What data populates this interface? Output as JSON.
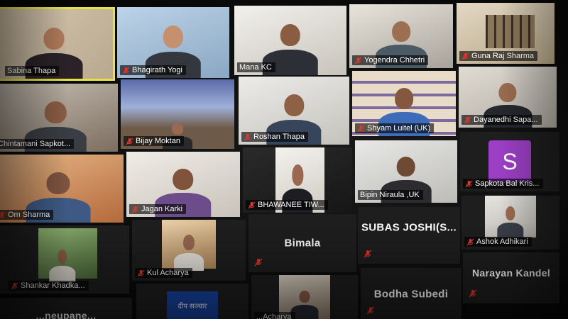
{
  "participants": [
    {
      "name": "Sabina Thapa",
      "muted": false,
      "active": true
    },
    {
      "name": "Bhagirath Yogi",
      "muted": true
    },
    {
      "name": "Mana KC",
      "muted": false
    },
    {
      "name": "Yogendra Chhetri",
      "muted": true
    },
    {
      "name": "Guna Raj Sharma",
      "muted": true
    },
    {
      "name": "Chintamani Sapkot...",
      "muted": false
    },
    {
      "name": "Bijay Moktan",
      "muted": true
    },
    {
      "name": "Roshan Thapa",
      "muted": true
    },
    {
      "name": "Shyam Luitel (UK)",
      "muted": true
    },
    {
      "name": "Dayanedhi Sapa...",
      "muted": true
    },
    {
      "name": "Om Sharma",
      "muted": true
    },
    {
      "name": "Jagan Karki",
      "muted": true
    },
    {
      "name": "BHAWANEE TIW...",
      "muted": true
    },
    {
      "name": "Bipin Niraula ,UK",
      "muted": false
    },
    {
      "name": "Sapkota Bal Kris...",
      "muted": true,
      "avatar_letter": "S"
    },
    {
      "name": "Shankar Khadka...",
      "muted": true
    },
    {
      "name": "Kul Acharya",
      "muted": true
    },
    {
      "name": "Bimala",
      "muted": true,
      "video_off": true
    },
    {
      "name": "SUBAS JOSHI(S...",
      "muted": true,
      "video_off": true
    },
    {
      "name": "Ashok Adhikari",
      "muted": true
    },
    {
      "name": "...neupane...",
      "video_off": true
    },
    {
      "name": "",
      "logo_text": "दीप सञ्चार"
    },
    {
      "name": "Bodha Subedi",
      "muted": true,
      "video_off": true
    },
    {
      "name": "...Acharya"
    },
    {
      "name": "Narayan Kandel",
      "muted": true,
      "video_off": true
    }
  ],
  "colors": {
    "muted_icon": "#e0362c",
    "active_border": "#e8e24a",
    "avatar_bg": "#9b3fc4",
    "tile_bg": "#1e1e1e"
  }
}
